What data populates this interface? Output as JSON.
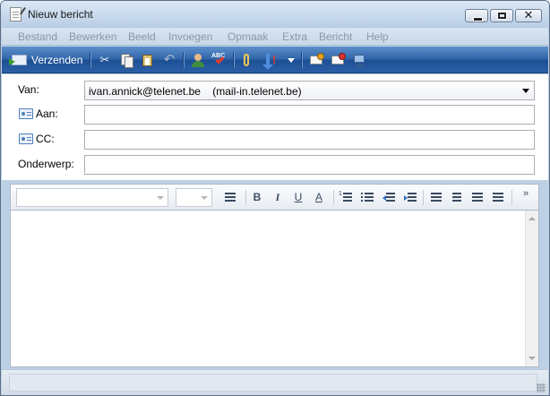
{
  "window": {
    "title": "Nieuw bericht"
  },
  "menu": {
    "items": [
      "Bestand",
      "Bewerken",
      "Beeld",
      "Invoegen",
      "Opmaak",
      "Extra",
      "Bericht",
      "Help"
    ]
  },
  "toolbar": {
    "send_label": "Verzenden",
    "icons": [
      "send-icon",
      "cut-icon",
      "copy-icon",
      "paste-icon",
      "undo-icon",
      "check-names-icon",
      "spelling-icon",
      "attach-icon",
      "priority-icon",
      "priority-dropdown-icon",
      "sign-icon",
      "encrypt-icon",
      "work-offline-icon"
    ]
  },
  "header": {
    "from_label": "Van:",
    "from_value": "ivan.annick@telenet.be    (mail-in.telenet.be)",
    "to_label": "Aan:",
    "to_value": "",
    "cc_label": "CC:",
    "cc_value": "",
    "subject_label": "Onderwerp:",
    "subject_value": ""
  },
  "formatting": {
    "font_name": "",
    "font_size": "",
    "bold_glyph": "B",
    "italic_glyph": "I",
    "underline_glyph": "U",
    "font_color_glyph": "A",
    "overflow_glyph": "»"
  },
  "body": {
    "text": ""
  },
  "status": {
    "text": ""
  },
  "colors": {
    "toolbar_top": "#5d8fcb",
    "toolbar_bottom": "#1d4f95",
    "frame": "#bcd0e6",
    "menu_text_disabled": "#8a97a6"
  }
}
